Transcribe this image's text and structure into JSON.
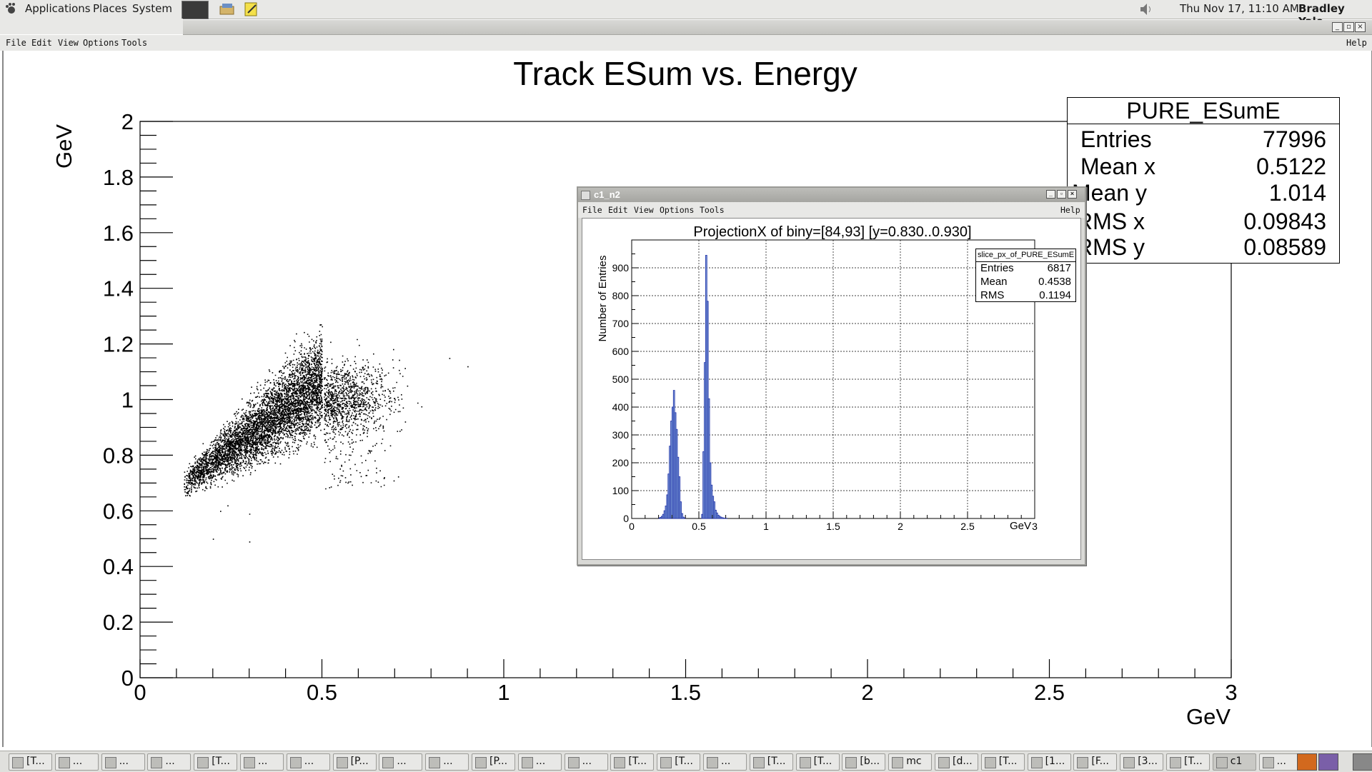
{
  "top_panel": {
    "menus": [
      "Applications",
      "Places",
      "System"
    ],
    "datetime": "Thu Nov 17, 11:10 AM",
    "user": "Bradley Yale"
  },
  "canvas_window": {
    "menu": [
      "File",
      "Edit",
      "View",
      "Options",
      "Tools"
    ],
    "help": "Help"
  },
  "main_chart": {
    "title": "Track ESum vs. Energy",
    "xlabel": "GeV",
    "ylabel": "GeV",
    "xticks": [
      "0",
      "0.5",
      "1",
      "1.5",
      "2",
      "2.5",
      "3"
    ],
    "yticks": [
      "0",
      "0.2",
      "0.4",
      "0.6",
      "0.8",
      "1",
      "1.2",
      "1.4",
      "1.6",
      "1.8",
      "2"
    ],
    "stats": {
      "title": "PURE_ESumE",
      "rows": [
        {
          "k": "Entries",
          "v": "77996"
        },
        {
          "k": "Mean x",
          "v": "0.5122"
        },
        {
          "k": "Mean y",
          "v": "1.014"
        },
        {
          "k": "RMS x",
          "v": "0.09843"
        },
        {
          "k": "RMS y",
          "v": "0.08589"
        }
      ]
    }
  },
  "sub_window": {
    "title": "c1_n2",
    "menu": [
      "File",
      "Edit",
      "View",
      "Options",
      "Tools"
    ],
    "help": "Help"
  },
  "chart_data": [
    {
      "type": "scatter",
      "title": "Track ESum vs. Energy",
      "xlabel": "GeV",
      "ylabel": "GeV",
      "xlim": [
        0,
        3
      ],
      "ylim": [
        0,
        2
      ],
      "regions": [
        {
          "x_range": [
            0.12,
            0.5
          ],
          "y_center_at_x_min": 0.7,
          "y_center_at_x_max": 1.07,
          "note": "diagonal band"
        },
        {
          "x_range": [
            0.5,
            0.87
          ],
          "y_range": [
            0.66,
            1.2
          ],
          "note": "dense cluster"
        }
      ]
    },
    {
      "type": "bar",
      "title": "ProjectionX of biny=[84,93] [y=0.830..0.930]",
      "xlabel": "GeV",
      "ylabel": "Number of Entries",
      "xlim": [
        0,
        3
      ],
      "ylim": [
        0,
        1000
      ],
      "xticks": [
        "0",
        "0.5",
        "1",
        "1.5",
        "2",
        "2.5",
        "3"
      ],
      "yticks": [
        "0",
        "100",
        "200",
        "300",
        "400",
        "500",
        "600",
        "700",
        "800",
        "900"
      ],
      "bin_width": 0.01,
      "x": [
        0.2,
        0.21,
        0.22,
        0.23,
        0.24,
        0.25,
        0.26,
        0.27,
        0.28,
        0.29,
        0.3,
        0.31,
        0.32,
        0.33,
        0.34,
        0.35,
        0.36,
        0.37,
        0.38,
        0.39,
        0.4,
        0.41,
        0.42,
        0.43,
        0.44,
        0.45,
        0.46,
        0.47,
        0.48,
        0.49,
        0.5,
        0.51,
        0.52,
        0.53,
        0.54,
        0.55,
        0.56,
        0.57,
        0.58,
        0.59,
        0.6,
        0.61,
        0.62,
        0.63,
        0.64,
        0.65,
        0.66,
        0.67,
        0.68,
        0.69,
        0.7,
        0.71
      ],
      "values": [
        2,
        4,
        8,
        15,
        28,
        45,
        85,
        160,
        260,
        350,
        400,
        460,
        380,
        320,
        220,
        150,
        60,
        18,
        5,
        2,
        0,
        0,
        0,
        0,
        0,
        0,
        0,
        0,
        0,
        0,
        0,
        0,
        15,
        240,
        560,
        945,
        780,
        430,
        200,
        120,
        80,
        60,
        30,
        20,
        12,
        8,
        5,
        3,
        2,
        1,
        1,
        0
      ],
      "stats": {
        "title": "slice_px_of_PURE_ESumE",
        "rows": [
          {
            "k": "Entries",
            "v": "6817"
          },
          {
            "k": "Mean",
            "v": "0.4538"
          },
          {
            "k": "RMS",
            "v": "0.1194"
          }
        ]
      }
    }
  ],
  "taskbar": {
    "items": [
      "[T...",
      "...",
      "...",
      "...",
      "[T...",
      "...",
      "...",
      "[P...",
      "...",
      "...",
      "[P...",
      "...",
      "...",
      "[T...",
      "[T...",
      "...",
      "[T...",
      "[T...",
      "[b...",
      "mc",
      "[d...",
      "[T...",
      "[1...",
      "[F...",
      "[3...",
      "[T...",
      "c1",
      "..."
    ],
    "active_index": 26
  }
}
